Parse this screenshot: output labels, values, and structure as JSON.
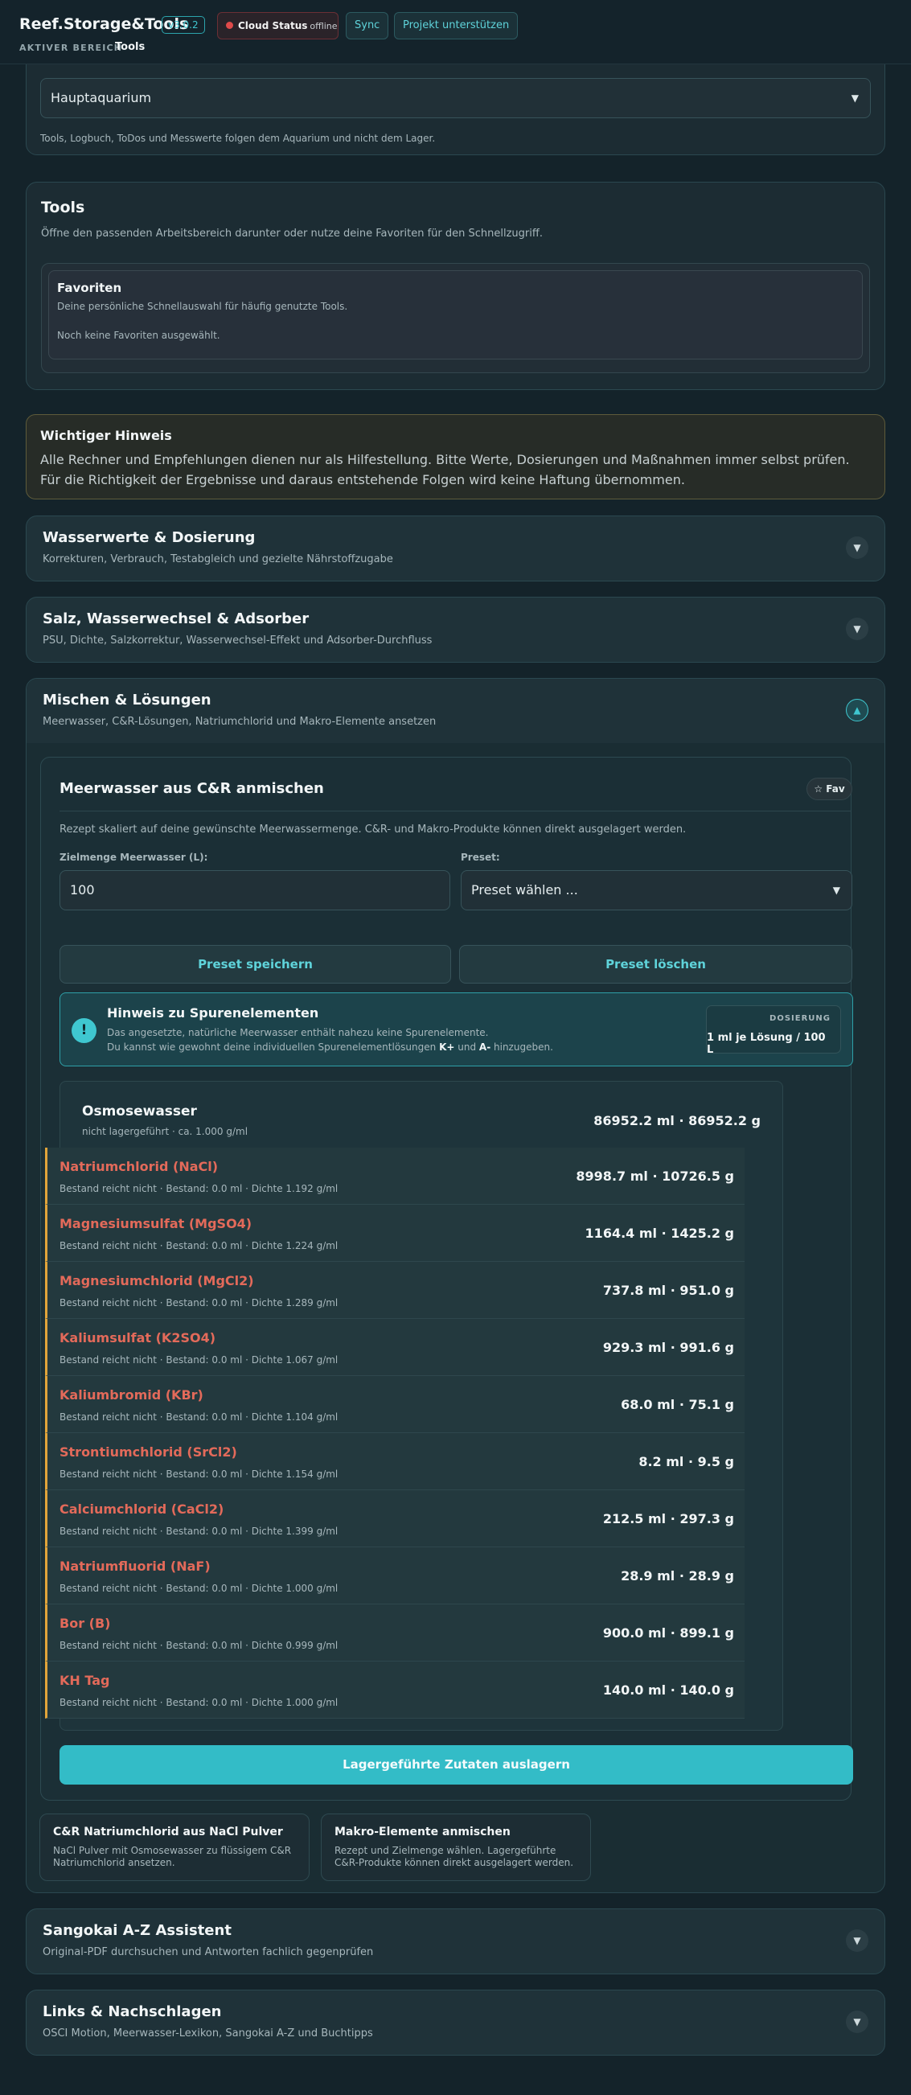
{
  "header": {
    "brand": "Reef.Storage&Tools",
    "version": "v3.0.2",
    "cloud_label": "Cloud Status",
    "cloud_state": "offline",
    "sync_label": "Sync",
    "support_label": "Projekt unterstützen",
    "area_label": "AKTIVER BEREICH",
    "area_value": "Tools"
  },
  "aquarium": {
    "selected": "Hauptaquarium",
    "hint": "Tools, Logbuch, ToDos und Messwerte folgen dem Aquarium und nicht dem Lager."
  },
  "tools": {
    "title": "Tools",
    "subtitle": "Öffne den passenden Arbeitsbereich darunter oder nutze deine Favoriten für den Schnellzugriff.",
    "favorites_title": "Favoriten",
    "favorites_sub": "Deine persönliche Schnellauswahl für häufig genutzte Tools.",
    "favorites_empty": "Noch keine Favoriten ausgewählt."
  },
  "notice": {
    "title": "Wichtiger Hinweis",
    "text": "Alle Rechner und Empfehlungen dienen nur als Hilfestellung. Bitte Werte, Dosierungen und Maßnahmen immer selbst prüfen. Für die Richtigkeit der Ergebnisse und daraus entstehende Folgen wird keine Haftung übernommen."
  },
  "sections": [
    {
      "title": "Wasserwerte & Dosierung",
      "subtitle": "Korrekturen, Verbrauch, Testabgleich und gezielte Nährstoffzugabe"
    },
    {
      "title": "Salz, Wasserwechsel & Adsorber",
      "subtitle": "PSU, Dichte, Salzkorrektur, Wasserwechsel-Effekt und Adsorber-Durchfluss"
    },
    {
      "title": "Mischen & Lösungen",
      "subtitle": "Meerwasser, C&R-Lösungen, Natriumchlorid und Makro-Elemente ansetzen"
    },
    {
      "title": "Sangokai A-Z Assistent",
      "subtitle": "Original-PDF durchsuchen und Antworten fachlich gegenprüfen"
    },
    {
      "title": "Links & Nachschlagen",
      "subtitle": "OSCI Motion, Meerwasser-Lexikon, Sangokai A-Z und Buchtipps"
    }
  ],
  "mix": {
    "title": "Meerwasser aus C&R anmischen",
    "fav_label": "☆ Fav",
    "desc": "Rezept skaliert auf deine gewünschte Meerwassermenge. C&R- und Makro-Produkte können direkt ausgelagert werden.",
    "target_label": "Zielmenge Meerwasser (L):",
    "target_value": "100",
    "preset_label": "Preset:",
    "preset_placeholder": "Preset wählen ...",
    "save_preset": "Preset speichern",
    "delete_preset": "Preset löschen",
    "trace_title": "Hinweis zu Spurenelementen",
    "trace_line1": "Das angesetzte, natürliche Meerwasser enthält nahezu keine Spurenelemente.",
    "trace_line2_a": "Du kannst wie gewohnt deine individuellen Spurenelementlösungen",
    "trace_k": "K+",
    "trace_und": "und",
    "trace_a": "A-",
    "trace_line2_b": "hinzugeben.",
    "dose_label": "DOSIERUNG",
    "dose_value": "1 ml je Lösung / 100 L",
    "water_name": "Osmosewasser",
    "water_meta": "nicht lagergeführt · ca. 1.000 g/ml",
    "water_value": "86952.2 ml · 86952.2 g",
    "ingredients": [
      {
        "name": "Natriumchlorid (NaCl)",
        "meta": "Bestand reicht nicht · Bestand: 0.0 ml · Dichte 1.192 g/ml",
        "value": "8998.7 ml · 10726.5 g"
      },
      {
        "name": "Magnesiumsulfat (MgSO4)",
        "meta": "Bestand reicht nicht · Bestand: 0.0 ml · Dichte 1.224 g/ml",
        "value": "1164.4 ml · 1425.2 g"
      },
      {
        "name": "Magnesiumchlorid (MgCl2)",
        "meta": "Bestand reicht nicht · Bestand: 0.0 ml · Dichte 1.289 g/ml",
        "value": "737.8 ml · 951.0 g"
      },
      {
        "name": "Kaliumsulfat (K2SO4)",
        "meta": "Bestand reicht nicht · Bestand: 0.0 ml · Dichte 1.067 g/ml",
        "value": "929.3 ml · 991.6 g"
      },
      {
        "name": "Kaliumbromid (KBr)",
        "meta": "Bestand reicht nicht · Bestand: 0.0 ml · Dichte 1.104 g/ml",
        "value": "68.0 ml · 75.1 g"
      },
      {
        "name": "Strontiumchlorid (SrCl2)",
        "meta": "Bestand reicht nicht · Bestand: 0.0 ml · Dichte 1.154 g/ml",
        "value": "8.2 ml · 9.5 g"
      },
      {
        "name": "Calciumchlorid (CaCl2)",
        "meta": "Bestand reicht nicht · Bestand: 0.0 ml · Dichte 1.399 g/ml",
        "value": "212.5 ml · 297.3 g"
      },
      {
        "name": "Natriumfluorid (NaF)",
        "meta": "Bestand reicht nicht · Bestand: 0.0 ml · Dichte 1.000 g/ml",
        "value": "28.9 ml · 28.9 g"
      },
      {
        "name": "Bor (B)",
        "meta": "Bestand reicht nicht · Bestand: 0.0 ml · Dichte 0.999 g/ml",
        "value": "900.0 ml · 899.1 g"
      },
      {
        "name": "KH Tag",
        "meta": "Bestand reicht nicht · Bestand: 0.0 ml · Dichte 1.000 g/ml",
        "value": "140.0 ml · 140.0 g"
      }
    ],
    "remove_stock": "Lagergeführte Zutaten auslagern"
  },
  "subtools": [
    {
      "title": "C&R Natriumchlorid aus NaCl Pulver",
      "desc": "NaCl Pulver mit Osmosewasser zu flüssigem C&R Natriumchlorid ansetzen."
    },
    {
      "title": "Makro-Elemente anmischen",
      "desc": "Rezept und Zielmenge wählen. Lagergeführte C&R-Produkte können direkt ausgelagert werden."
    }
  ],
  "colors": {
    "accent": "#3fc7d0",
    "warn": "#e1a43a",
    "alert": "#e36a5a",
    "offline": "#e04a4a"
  },
  "icons": {
    "chevron": "chevron-down-icon",
    "chevron_open": "chevron-up-icon",
    "info": "exclamation-icon",
    "star": "star-icon"
  }
}
